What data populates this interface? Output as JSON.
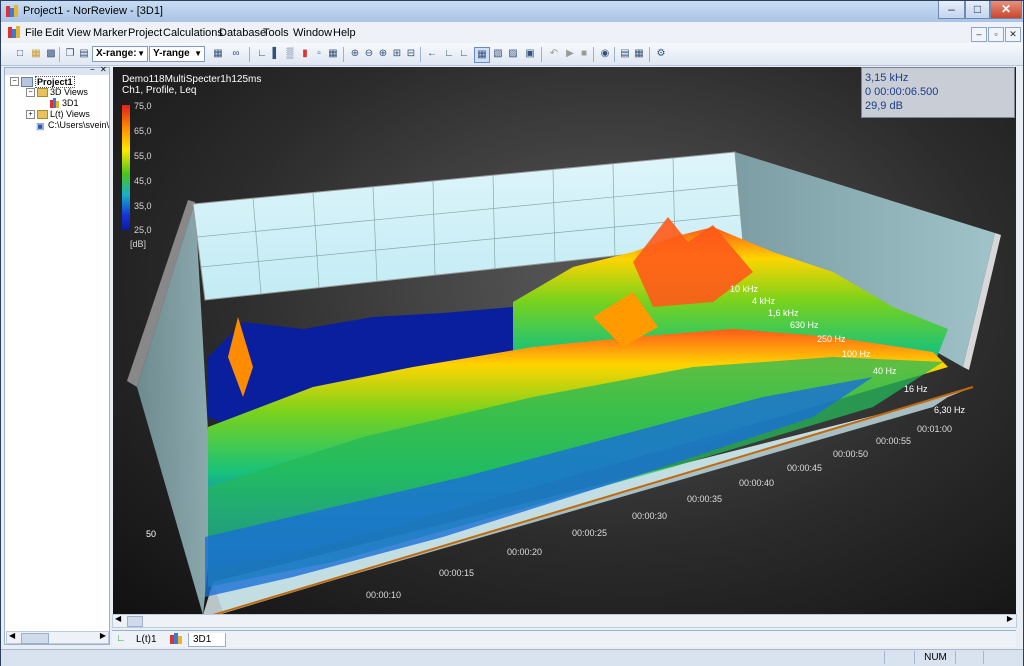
{
  "window": {
    "title": "Project1 - NorReview - [3D1]"
  },
  "menu": [
    "File",
    "Edit",
    "View",
    "Marker",
    "Project",
    "Calculations",
    "Database",
    "Tools",
    "Window",
    "Help"
  ],
  "toolbar": {
    "xrange_label": "X-range:",
    "yrange_label": "Y-range"
  },
  "tree": {
    "root": "Project1",
    "views3d": "3D Views",
    "view3d_item": "3D1",
    "lt_views": "L(t) Views",
    "path": "C:\\Users\\svein\\"
  },
  "plot": {
    "header_line1": "Demo118MultiSpecter1h125ms",
    "header_line2": "Ch1, Profile, Leq",
    "info": [
      "3,15 kHz",
      "0 00:00:06.500",
      "29,9 dB"
    ],
    "colorbar_ticks": [
      "75,0",
      "65,0",
      "55,0",
      "45,0",
      "35,0",
      "25,0"
    ],
    "colorbar_unit": "[dB]",
    "time_labels": [
      "00:00:10",
      "00:00:15",
      "00:00:20",
      "00:00:25",
      "00:00:30",
      "00:00:35",
      "00:00:40",
      "00:00:45",
      "00:00:50",
      "00:00:55",
      "00:01:00"
    ],
    "freq_labels": [
      "10 kHz",
      "4 kHz",
      "1,6 kHz",
      "630 Hz",
      "250 Hz",
      "100 Hz",
      "40 Hz",
      "16 Hz",
      "6,30 Hz"
    ],
    "z_label": "50"
  },
  "tabs": [
    "L(t)1",
    "3D1"
  ],
  "status": {
    "num": "NUM"
  }
}
